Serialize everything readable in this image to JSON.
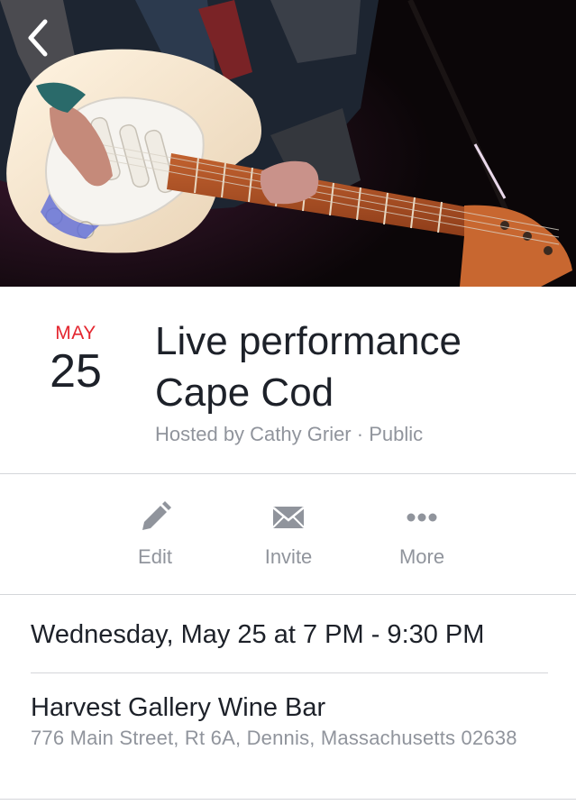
{
  "cover": {
    "image": "guitarist-playing-electric-guitar-photo",
    "back_icon": "chevron-left-icon"
  },
  "event": {
    "month": "MAY",
    "day": "25",
    "title": "Live performance Cape Cod",
    "subtitle": "Hosted by Cathy Grier · Public"
  },
  "actions": [
    {
      "label": "Edit",
      "icon": "pencil-icon"
    },
    {
      "label": "Invite",
      "icon": "envelope-icon"
    },
    {
      "label": "More",
      "icon": "more-dots-icon"
    }
  ],
  "details": {
    "when": "Wednesday, May 25 at 7 PM - 9:30 PM",
    "venue": "Harvest Gallery Wine Bar",
    "address": "776 Main Street, Rt 6A, Dennis, Massachusetts 02638"
  },
  "colors": {
    "accent_red": "#e4262f",
    "text_primary": "#1d2129",
    "text_secondary": "#90949c",
    "divider": "#d4d6da"
  }
}
